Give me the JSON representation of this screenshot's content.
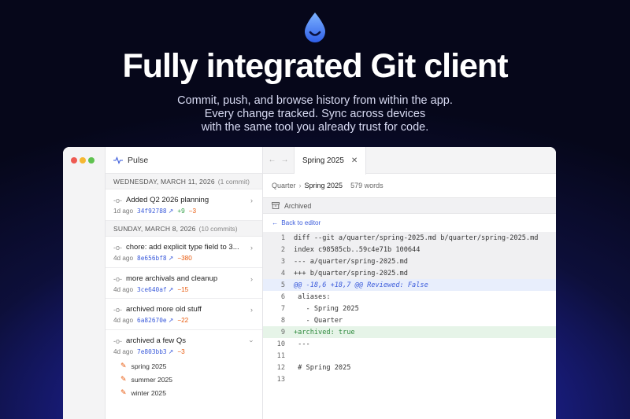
{
  "hero": {
    "headline": "Fully integrated Git client",
    "subline_1": "Commit, push, and browse history from within the app.",
    "subline_2": "Every change tracked. Sync across devices",
    "subline_3": "with the same tool you already trust for code.",
    "logo_icon": "water-drop-icon",
    "colors": {
      "background": "#0d0f3a",
      "accent": "#3b5bdb"
    }
  },
  "window": {
    "traffic_colors": [
      "#ee5a52",
      "#f5b731",
      "#5fc24f"
    ],
    "list_pane": {
      "title": "Pulse",
      "title_icon": "activity-icon",
      "groups": [
        {
          "date": "WEDNESDAY, MARCH 11, 2026",
          "count": "(1 commit)",
          "commits": [
            {
              "title": "Added Q2 2026 planning",
              "age": "1d ago",
              "hash": "34f92788",
              "added": "+9",
              "removed": "−3",
              "expanded": false
            }
          ]
        },
        {
          "date": "SUNDAY, MARCH 8, 2026",
          "count": "(10 commits)",
          "commits": [
            {
              "title": "chore: add explicit type field to 3...",
              "age": "4d ago",
              "hash": "8e656bf8",
              "added": "",
              "removed": "−380",
              "expanded": false
            },
            {
              "title": "more archivals and cleanup",
              "age": "4d ago",
              "hash": "3ce640af",
              "added": "",
              "removed": "−15",
              "expanded": false
            },
            {
              "title": "archived more old stuff",
              "age": "4d ago",
              "hash": "6a82670e",
              "added": "",
              "removed": "−22",
              "expanded": false
            },
            {
              "title": "archived a few Qs",
              "age": "4d ago",
              "hash": "7e803bb3",
              "added": "",
              "removed": "−3",
              "expanded": true,
              "files": [
                "spring 2025",
                "summer 2025",
                "winter 2025"
              ]
            }
          ]
        }
      ]
    },
    "editor": {
      "tab_label": "Spring 2025",
      "breadcrumb": {
        "parent": "Quarter",
        "current": "Spring 2025",
        "word_count": "579 words"
      },
      "archived_label": "Archived",
      "back_label": "Back to editor",
      "diff_lines": [
        {
          "n": "1",
          "text": "diff --git a/quarter/spring-2025.md b/quarter/spring-2025.md",
          "kind": "hdr"
        },
        {
          "n": "2",
          "text": "index c98585cb..59c4e71b 100644",
          "kind": "hdr"
        },
        {
          "n": "3",
          "text": "--- a/quarter/spring-2025.md",
          "kind": "hdr"
        },
        {
          "n": "4",
          "text": "+++ b/quarter/spring-2025.md",
          "kind": "hdr"
        },
        {
          "n": "5",
          "text": "@@ -18,6 +18,7 @@ Reviewed: False",
          "kind": "hunk"
        },
        {
          "n": "6",
          "text": " aliases:",
          "kind": "ctx"
        },
        {
          "n": "7",
          "text": "   - Spring 2025",
          "kind": "ctx"
        },
        {
          "n": "8",
          "text": "   - Quarter",
          "kind": "ctx"
        },
        {
          "n": "9",
          "text": "+archived: true",
          "kind": "add"
        },
        {
          "n": "10",
          "text": " ---",
          "kind": "ctx"
        },
        {
          "n": "11",
          "text": "",
          "kind": "ctx"
        },
        {
          "n": "12",
          "text": " # Spring 2025",
          "kind": "ctx"
        },
        {
          "n": "13",
          "text": "",
          "kind": "ctx"
        }
      ]
    }
  }
}
